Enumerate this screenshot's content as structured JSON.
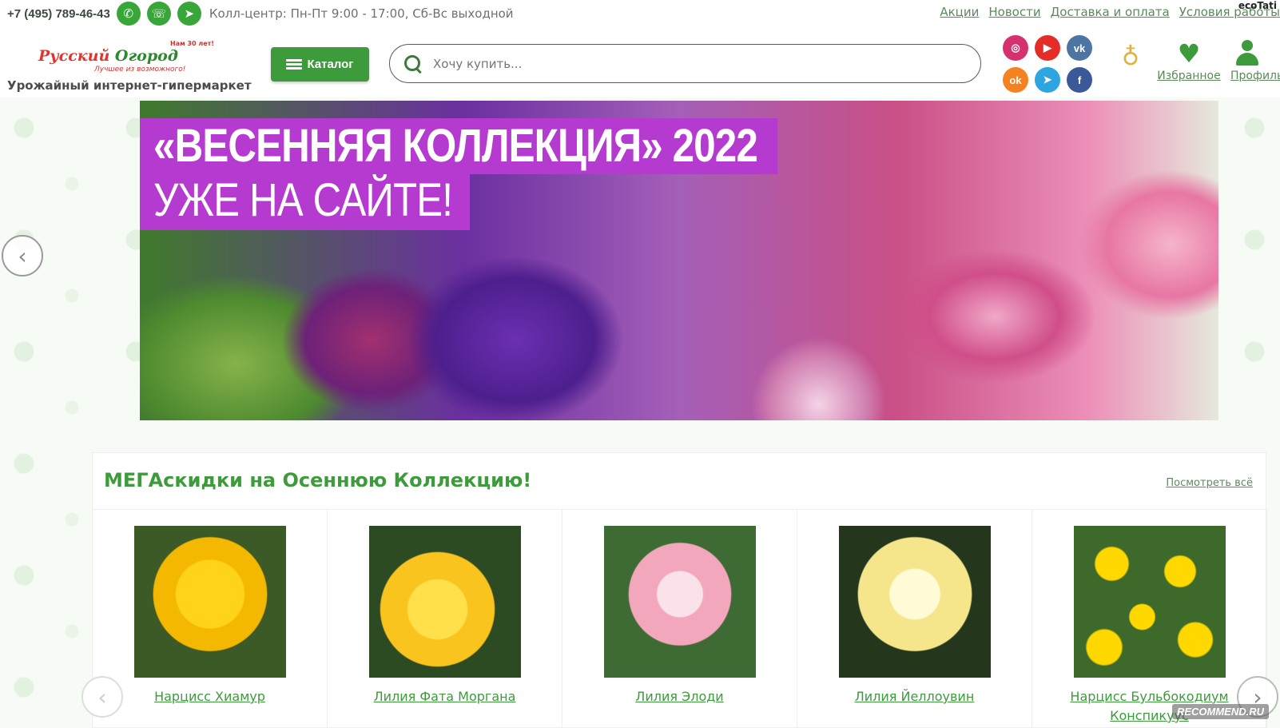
{
  "topbar": {
    "phone": "+7 (495) 789-46-43",
    "call_center": "Колл-центр: Пн-Пт 9:00 - 17:00, Сб-Вс выходной",
    "links": [
      "Акции",
      "Новости",
      "Доставка и оплата",
      "Условия работы"
    ],
    "user": "ecoTati"
  },
  "header": {
    "logo": {
      "word1": "Русский",
      "word2": "Огород",
      "tagline": "Лучшее из возможного!",
      "badge": "Нам 30 лет!"
    },
    "tagline": "Урожайный интернет-гипермаркет",
    "catalog_label": "Каталог",
    "search_placeholder": "Хочу купить...",
    "socials": [
      {
        "name": "instagram-icon",
        "glyph": "◎",
        "color": "#d6306f"
      },
      {
        "name": "youtube-icon",
        "glyph": "▶",
        "color": "#e52d27"
      },
      {
        "name": "vk-icon",
        "glyph": "vk",
        "color": "#4c75a3"
      },
      {
        "name": "odnoklassniki-icon",
        "glyph": "ok",
        "color": "#f58220"
      },
      {
        "name": "telegram-icon",
        "glyph": "➤",
        "color": "#2ca5e0"
      },
      {
        "name": "facebook-icon",
        "glyph": "f",
        "color": "#3b5998"
      }
    ],
    "favorites_label": "Избранное",
    "profile_label": "Профиль"
  },
  "banner": {
    "line1": "«ВЕСЕННЯЯ КОЛЛЕКЦИЯ» 2022",
    "line2": "УЖЕ НА САЙТЕ!"
  },
  "promo": {
    "title": "МЕГАскидки на Осеннюю Коллекцию!",
    "view_all": "Посмотреть всё",
    "products": [
      {
        "name": "Нарцисс Хиамур",
        "img": "img-yellow"
      },
      {
        "name": "Лилия Фата Моргана",
        "img": "img-lily"
      },
      {
        "name": "Лилия Элоди",
        "img": "img-pink"
      },
      {
        "name": "Лилия Йеллоувин",
        "img": "img-cream"
      },
      {
        "name": "Нарцисс Бульбокодиум Конспикуус",
        "img": "img-narc"
      }
    ]
  },
  "watermark": "RECOMMEND.RU",
  "colors": {
    "brand_green": "#3d9b3c",
    "banner_purple": "#b43ad0"
  }
}
